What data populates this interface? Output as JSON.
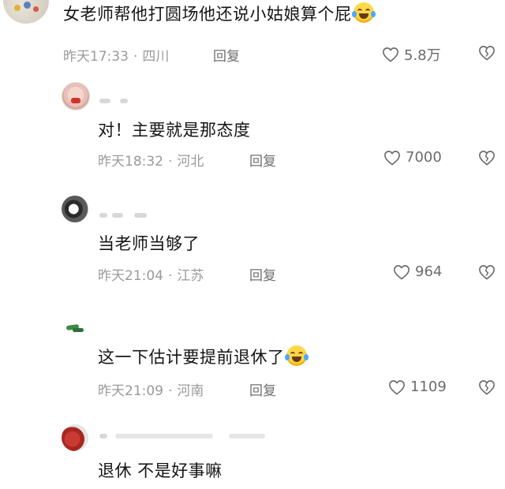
{
  "comments": [
    {
      "text": "女老师帮他打圆场他还说小姑娘算个屁",
      "emoji": "laugh-cry-emoji",
      "time": "昨天17:33",
      "region": "四川",
      "reply": "回复",
      "likes": "5.8万"
    }
  ],
  "replies": [
    {
      "text": "对！主要就是那态度",
      "time": "昨天18:32",
      "region": "河北",
      "reply": "回复",
      "likes": "7000"
    },
    {
      "text": "当老师当够了",
      "time": "昨天21:04",
      "region": "江苏",
      "reply": "回复",
      "likes": "964"
    },
    {
      "text": "这一下估计要提前退休了",
      "emoji": "laugh-cry-emoji",
      "time": "昨天21:09",
      "region": "河南",
      "reply": "回复",
      "likes": "1109"
    },
    {
      "text": "退休 不是好事嘛"
    }
  ],
  "separator": "·",
  "icons": {
    "like": "heart-outline-icon",
    "dislike": "broken-heart-icon"
  },
  "colors": {
    "text": "#151515",
    "meta": "#9a9a9a",
    "icon": "#6b6b6b"
  }
}
